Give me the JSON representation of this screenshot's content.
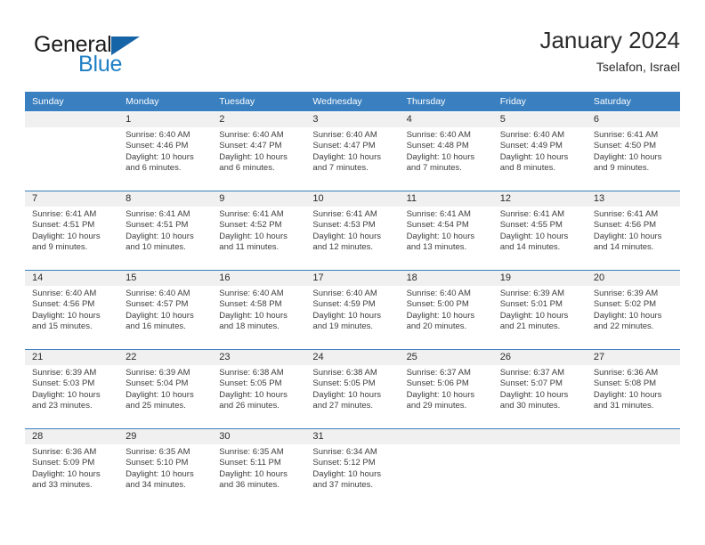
{
  "brand": {
    "name_part1": "General",
    "name_part2": "Blue",
    "triangle_color": "#1564a8",
    "blue_color": "#1f7fc4"
  },
  "header": {
    "title": "January 2024",
    "subtitle": "Tselafon, Israel"
  },
  "theme": {
    "header_bar": "#3a7fbf",
    "number_band": "#f0f0f0",
    "cell_bg": "#ffffff",
    "text": "#2b2b2b"
  },
  "weekdays": [
    "Sunday",
    "Monday",
    "Tuesday",
    "Wednesday",
    "Thursday",
    "Friday",
    "Saturday"
  ],
  "weeks": [
    [
      {
        "day": "",
        "lines": [
          "",
          "",
          "",
          ""
        ]
      },
      {
        "day": "1",
        "lines": [
          "Sunrise: 6:40 AM",
          "Sunset: 4:46 PM",
          "Daylight: 10 hours",
          "and 6 minutes."
        ]
      },
      {
        "day": "2",
        "lines": [
          "Sunrise: 6:40 AM",
          "Sunset: 4:47 PM",
          "Daylight: 10 hours",
          "and 6 minutes."
        ]
      },
      {
        "day": "3",
        "lines": [
          "Sunrise: 6:40 AM",
          "Sunset: 4:47 PM",
          "Daylight: 10 hours",
          "and 7 minutes."
        ]
      },
      {
        "day": "4",
        "lines": [
          "Sunrise: 6:40 AM",
          "Sunset: 4:48 PM",
          "Daylight: 10 hours",
          "and 7 minutes."
        ]
      },
      {
        "day": "5",
        "lines": [
          "Sunrise: 6:40 AM",
          "Sunset: 4:49 PM",
          "Daylight: 10 hours",
          "and 8 minutes."
        ]
      },
      {
        "day": "6",
        "lines": [
          "Sunrise: 6:41 AM",
          "Sunset: 4:50 PM",
          "Daylight: 10 hours",
          "and 9 minutes."
        ]
      }
    ],
    [
      {
        "day": "7",
        "lines": [
          "Sunrise: 6:41 AM",
          "Sunset: 4:51 PM",
          "Daylight: 10 hours",
          "and 9 minutes."
        ]
      },
      {
        "day": "8",
        "lines": [
          "Sunrise: 6:41 AM",
          "Sunset: 4:51 PM",
          "Daylight: 10 hours",
          "and 10 minutes."
        ]
      },
      {
        "day": "9",
        "lines": [
          "Sunrise: 6:41 AM",
          "Sunset: 4:52 PM",
          "Daylight: 10 hours",
          "and 11 minutes."
        ]
      },
      {
        "day": "10",
        "lines": [
          "Sunrise: 6:41 AM",
          "Sunset: 4:53 PM",
          "Daylight: 10 hours",
          "and 12 minutes."
        ]
      },
      {
        "day": "11",
        "lines": [
          "Sunrise: 6:41 AM",
          "Sunset: 4:54 PM",
          "Daylight: 10 hours",
          "and 13 minutes."
        ]
      },
      {
        "day": "12",
        "lines": [
          "Sunrise: 6:41 AM",
          "Sunset: 4:55 PM",
          "Daylight: 10 hours",
          "and 14 minutes."
        ]
      },
      {
        "day": "13",
        "lines": [
          "Sunrise: 6:41 AM",
          "Sunset: 4:56 PM",
          "Daylight: 10 hours",
          "and 14 minutes."
        ]
      }
    ],
    [
      {
        "day": "14",
        "lines": [
          "Sunrise: 6:40 AM",
          "Sunset: 4:56 PM",
          "Daylight: 10 hours",
          "and 15 minutes."
        ]
      },
      {
        "day": "15",
        "lines": [
          "Sunrise: 6:40 AM",
          "Sunset: 4:57 PM",
          "Daylight: 10 hours",
          "and 16 minutes."
        ]
      },
      {
        "day": "16",
        "lines": [
          "Sunrise: 6:40 AM",
          "Sunset: 4:58 PM",
          "Daylight: 10 hours",
          "and 18 minutes."
        ]
      },
      {
        "day": "17",
        "lines": [
          "Sunrise: 6:40 AM",
          "Sunset: 4:59 PM",
          "Daylight: 10 hours",
          "and 19 minutes."
        ]
      },
      {
        "day": "18",
        "lines": [
          "Sunrise: 6:40 AM",
          "Sunset: 5:00 PM",
          "Daylight: 10 hours",
          "and 20 minutes."
        ]
      },
      {
        "day": "19",
        "lines": [
          "Sunrise: 6:39 AM",
          "Sunset: 5:01 PM",
          "Daylight: 10 hours",
          "and 21 minutes."
        ]
      },
      {
        "day": "20",
        "lines": [
          "Sunrise: 6:39 AM",
          "Sunset: 5:02 PM",
          "Daylight: 10 hours",
          "and 22 minutes."
        ]
      }
    ],
    [
      {
        "day": "21",
        "lines": [
          "Sunrise: 6:39 AM",
          "Sunset: 5:03 PM",
          "Daylight: 10 hours",
          "and 23 minutes."
        ]
      },
      {
        "day": "22",
        "lines": [
          "Sunrise: 6:39 AM",
          "Sunset: 5:04 PM",
          "Daylight: 10 hours",
          "and 25 minutes."
        ]
      },
      {
        "day": "23",
        "lines": [
          "Sunrise: 6:38 AM",
          "Sunset: 5:05 PM",
          "Daylight: 10 hours",
          "and 26 minutes."
        ]
      },
      {
        "day": "24",
        "lines": [
          "Sunrise: 6:38 AM",
          "Sunset: 5:05 PM",
          "Daylight: 10 hours",
          "and 27 minutes."
        ]
      },
      {
        "day": "25",
        "lines": [
          "Sunrise: 6:37 AM",
          "Sunset: 5:06 PM",
          "Daylight: 10 hours",
          "and 29 minutes."
        ]
      },
      {
        "day": "26",
        "lines": [
          "Sunrise: 6:37 AM",
          "Sunset: 5:07 PM",
          "Daylight: 10 hours",
          "and 30 minutes."
        ]
      },
      {
        "day": "27",
        "lines": [
          "Sunrise: 6:36 AM",
          "Sunset: 5:08 PM",
          "Daylight: 10 hours",
          "and 31 minutes."
        ]
      }
    ],
    [
      {
        "day": "28",
        "lines": [
          "Sunrise: 6:36 AM",
          "Sunset: 5:09 PM",
          "Daylight: 10 hours",
          "and 33 minutes."
        ]
      },
      {
        "day": "29",
        "lines": [
          "Sunrise: 6:35 AM",
          "Sunset: 5:10 PM",
          "Daylight: 10 hours",
          "and 34 minutes."
        ]
      },
      {
        "day": "30",
        "lines": [
          "Sunrise: 6:35 AM",
          "Sunset: 5:11 PM",
          "Daylight: 10 hours",
          "and 36 minutes."
        ]
      },
      {
        "day": "31",
        "lines": [
          "Sunrise: 6:34 AM",
          "Sunset: 5:12 PM",
          "Daylight: 10 hours",
          "and 37 minutes."
        ]
      },
      {
        "day": "",
        "lines": [
          "",
          "",
          "",
          ""
        ]
      },
      {
        "day": "",
        "lines": [
          "",
          "",
          "",
          ""
        ]
      },
      {
        "day": "",
        "lines": [
          "",
          "",
          "",
          ""
        ]
      }
    ]
  ]
}
